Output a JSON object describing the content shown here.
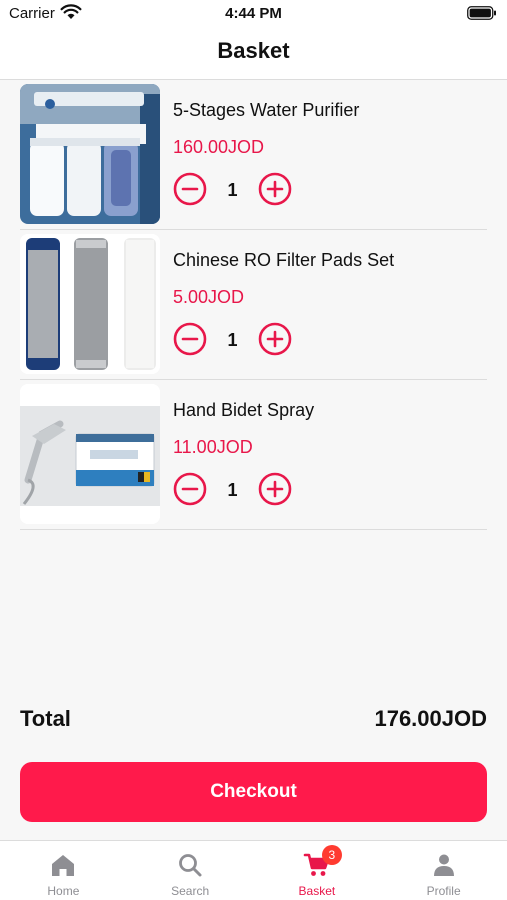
{
  "status_bar": {
    "carrier": "Carrier",
    "time": "4:44 PM"
  },
  "nav": {
    "title": "Basket"
  },
  "basket": {
    "items": [
      {
        "name": "5-Stages Water Purifier",
        "price": "160.00JOD",
        "quantity": "1",
        "image_icon": "water-purifier-photo"
      },
      {
        "name": "Chinese RO Filter Pads Set",
        "price": "5.00JOD",
        "quantity": "1",
        "image_icon": "filter-cartridges-photo"
      },
      {
        "name": "Hand Bidet Spray",
        "price": "11.00JOD",
        "quantity": "1",
        "image_icon": "bidet-spray-photo"
      }
    ]
  },
  "summary": {
    "total_label": "Total",
    "total_value": "176.00JOD"
  },
  "checkout": {
    "label": "Checkout"
  },
  "tab_bar": {
    "tabs": [
      {
        "label": "Home",
        "icon": "home-icon"
      },
      {
        "label": "Search",
        "icon": "search-icon"
      },
      {
        "label": "Basket",
        "icon": "cart-icon",
        "badge": "3",
        "active": true
      },
      {
        "label": "Profile",
        "icon": "person-icon"
      }
    ]
  },
  "colors": {
    "accent": "#ff1a4b",
    "price": "#e8174a",
    "badge": "#ff3b30",
    "tab_inactive": "#8e8e93",
    "background": "#f7f7f7"
  }
}
